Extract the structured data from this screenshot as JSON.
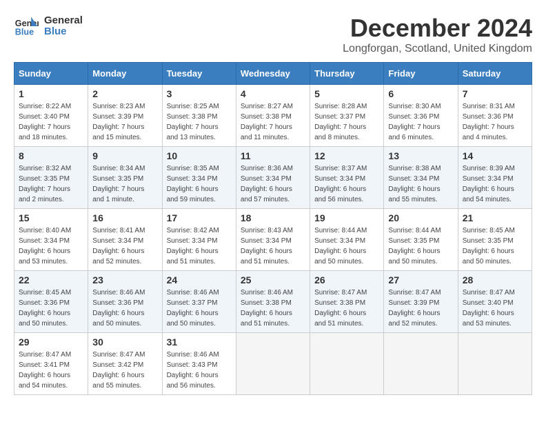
{
  "header": {
    "logo_line1": "General",
    "logo_line2": "Blue",
    "month": "December 2024",
    "location": "Longforgan, Scotland, United Kingdom"
  },
  "weekdays": [
    "Sunday",
    "Monday",
    "Tuesday",
    "Wednesday",
    "Thursday",
    "Friday",
    "Saturday"
  ],
  "weeks": [
    [
      {
        "day": "1",
        "sunrise": "8:22 AM",
        "sunset": "3:40 PM",
        "daylight": "7 hours and 18 minutes."
      },
      {
        "day": "2",
        "sunrise": "8:23 AM",
        "sunset": "3:39 PM",
        "daylight": "7 hours and 15 minutes."
      },
      {
        "day": "3",
        "sunrise": "8:25 AM",
        "sunset": "3:38 PM",
        "daylight": "7 hours and 13 minutes."
      },
      {
        "day": "4",
        "sunrise": "8:27 AM",
        "sunset": "3:38 PM",
        "daylight": "7 hours and 11 minutes."
      },
      {
        "day": "5",
        "sunrise": "8:28 AM",
        "sunset": "3:37 PM",
        "daylight": "7 hours and 8 minutes."
      },
      {
        "day": "6",
        "sunrise": "8:30 AM",
        "sunset": "3:36 PM",
        "daylight": "7 hours and 6 minutes."
      },
      {
        "day": "7",
        "sunrise": "8:31 AM",
        "sunset": "3:36 PM",
        "daylight": "7 hours and 4 minutes."
      }
    ],
    [
      {
        "day": "8",
        "sunrise": "8:32 AM",
        "sunset": "3:35 PM",
        "daylight": "7 hours and 2 minutes."
      },
      {
        "day": "9",
        "sunrise": "8:34 AM",
        "sunset": "3:35 PM",
        "daylight": "7 hours and 1 minute."
      },
      {
        "day": "10",
        "sunrise": "8:35 AM",
        "sunset": "3:34 PM",
        "daylight": "6 hours and 59 minutes."
      },
      {
        "day": "11",
        "sunrise": "8:36 AM",
        "sunset": "3:34 PM",
        "daylight": "6 hours and 57 minutes."
      },
      {
        "day": "12",
        "sunrise": "8:37 AM",
        "sunset": "3:34 PM",
        "daylight": "6 hours and 56 minutes."
      },
      {
        "day": "13",
        "sunrise": "8:38 AM",
        "sunset": "3:34 PM",
        "daylight": "6 hours and 55 minutes."
      },
      {
        "day": "14",
        "sunrise": "8:39 AM",
        "sunset": "3:34 PM",
        "daylight": "6 hours and 54 minutes."
      }
    ],
    [
      {
        "day": "15",
        "sunrise": "8:40 AM",
        "sunset": "3:34 PM",
        "daylight": "6 hours and 53 minutes."
      },
      {
        "day": "16",
        "sunrise": "8:41 AM",
        "sunset": "3:34 PM",
        "daylight": "6 hours and 52 minutes."
      },
      {
        "day": "17",
        "sunrise": "8:42 AM",
        "sunset": "3:34 PM",
        "daylight": "6 hours and 51 minutes."
      },
      {
        "day": "18",
        "sunrise": "8:43 AM",
        "sunset": "3:34 PM",
        "daylight": "6 hours and 51 minutes."
      },
      {
        "day": "19",
        "sunrise": "8:44 AM",
        "sunset": "3:34 PM",
        "daylight": "6 hours and 50 minutes."
      },
      {
        "day": "20",
        "sunrise": "8:44 AM",
        "sunset": "3:35 PM",
        "daylight": "6 hours and 50 minutes."
      },
      {
        "day": "21",
        "sunrise": "8:45 AM",
        "sunset": "3:35 PM",
        "daylight": "6 hours and 50 minutes."
      }
    ],
    [
      {
        "day": "22",
        "sunrise": "8:45 AM",
        "sunset": "3:36 PM",
        "daylight": "6 hours and 50 minutes."
      },
      {
        "day": "23",
        "sunrise": "8:46 AM",
        "sunset": "3:36 PM",
        "daylight": "6 hours and 50 minutes."
      },
      {
        "day": "24",
        "sunrise": "8:46 AM",
        "sunset": "3:37 PM",
        "daylight": "6 hours and 50 minutes."
      },
      {
        "day": "25",
        "sunrise": "8:46 AM",
        "sunset": "3:38 PM",
        "daylight": "6 hours and 51 minutes."
      },
      {
        "day": "26",
        "sunrise": "8:47 AM",
        "sunset": "3:38 PM",
        "daylight": "6 hours and 51 minutes."
      },
      {
        "day": "27",
        "sunrise": "8:47 AM",
        "sunset": "3:39 PM",
        "daylight": "6 hours and 52 minutes."
      },
      {
        "day": "28",
        "sunrise": "8:47 AM",
        "sunset": "3:40 PM",
        "daylight": "6 hours and 53 minutes."
      }
    ],
    [
      {
        "day": "29",
        "sunrise": "8:47 AM",
        "sunset": "3:41 PM",
        "daylight": "6 hours and 54 minutes."
      },
      {
        "day": "30",
        "sunrise": "8:47 AM",
        "sunset": "3:42 PM",
        "daylight": "6 hours and 55 minutes."
      },
      {
        "day": "31",
        "sunrise": "8:46 AM",
        "sunset": "3:43 PM",
        "daylight": "6 hours and 56 minutes."
      },
      null,
      null,
      null,
      null
    ]
  ]
}
